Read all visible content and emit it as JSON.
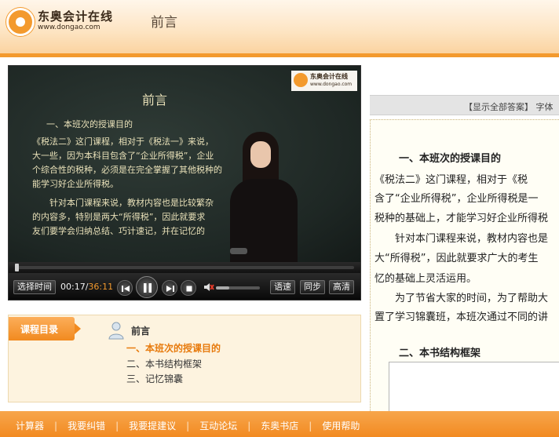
{
  "header": {
    "logo_name": "东奥会计在线",
    "logo_url": "www.dongao.com",
    "page_title": "前言"
  },
  "video": {
    "board": {
      "logo_name": "东奥会计在线",
      "logo_url": "www.dongao.com",
      "title": "前言",
      "heading": "一、本班次的授课目的",
      "lines": [
        "《税法二》这门课程，相对于《税法一》来说，",
        "大一些，因为本科目包含了“企业所得税”，企业",
        "个综合性的税种，必须是在完全掌握了其他税种的",
        "能学习好企业所得税。",
        "　　针对本门课程来说，教材内容也是比较繁杂",
        "的内容多，特别是两大“所得税”，因此就要求",
        "友们要学会归纳总结、巧计速记，并在记忆的"
      ]
    },
    "progress": 0.0047,
    "controls": {
      "select_time": "选择时间",
      "current_time": "00:17",
      "duration": "36:11",
      "speed": "语速",
      "sync": "同步",
      "hd": "高清"
    },
    "volume": 0.3
  },
  "panel": {
    "toolbar_text": "【显示全部答案】 字体",
    "heading1": "一、本班次的授课目的",
    "lines": [
      "《税法二》这门课程，相对于《税",
      "含了“企业所得税”，企业所得税是一",
      "税种的基础上，才能学习好企业所得税",
      "　　针对本门课程来说，教材内容也是",
      "大“所得税”，因此就要求广大的考生",
      "忆的基础上灵活运用。",
      "　　为了节省大家的时间，为了帮助大",
      "置了学习锦囊班，本班次通过不同的讲"
    ],
    "heading2": "二、本书结构框架"
  },
  "catalog": {
    "tab_label": "课程目录",
    "intro": "前言",
    "items": [
      {
        "label": "一、本班次的授课目的",
        "active": true
      },
      {
        "label": "二、本书结构框架",
        "active": false
      },
      {
        "label": "三、记忆锦囊",
        "active": false
      }
    ]
  },
  "footer": {
    "links": [
      "计算器",
      "我要纠错",
      "我要提建议",
      "互动论坛",
      "东奥书店",
      "使用帮助"
    ]
  },
  "colors": {
    "accent": "#f39a2e",
    "active_item": "#e77a0c",
    "time_duration": "#f39a2e"
  }
}
